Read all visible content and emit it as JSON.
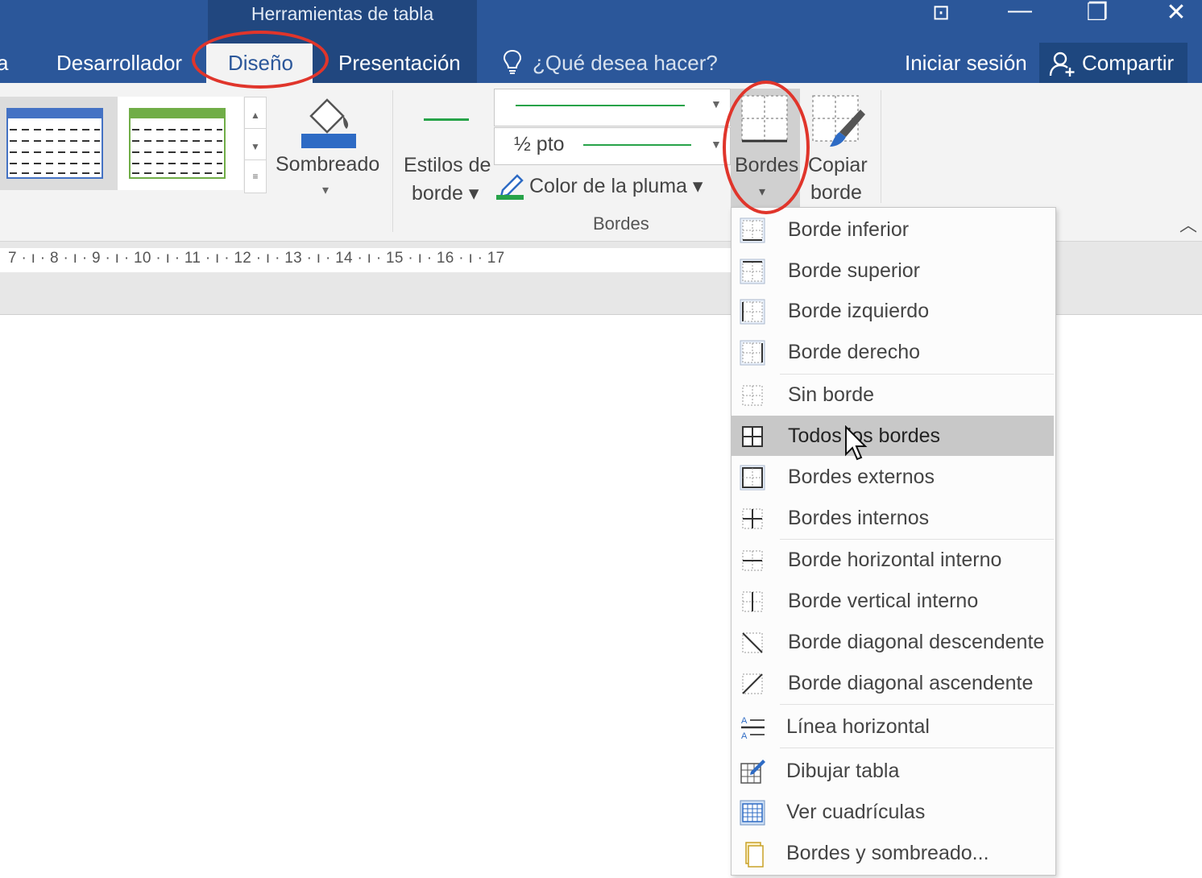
{
  "window": {
    "context_group": "Herramientas de tabla",
    "controls": {
      "ribbon_display": "⊡",
      "minimize": "—",
      "restore": "❐",
      "close": "✕"
    }
  },
  "tabs": [
    {
      "label": "a"
    },
    {
      "label": "Desarrollador"
    },
    {
      "label": "Diseño",
      "selected": true
    },
    {
      "label": "Presentación"
    }
  ],
  "tell_me": {
    "placeholder": "¿Qué desea hacer?"
  },
  "account": {
    "sign_in": "Iniciar sesión",
    "share": "Compartir"
  },
  "ribbon": {
    "shading": {
      "label": "Sombreado",
      "arrow": "▾"
    },
    "border_styles": {
      "line1": "Estilos de",
      "line2": "borde ▾"
    },
    "pen_weight": {
      "value": "½ pto"
    },
    "pen_color": {
      "label": "Color de la pluma ▾",
      "color": "#27a349"
    },
    "group_label": "Bordes",
    "borders_button": {
      "label": "Bordes",
      "arrow": "▾"
    },
    "border_painter": {
      "line1": "Copiar",
      "line2": "borde"
    },
    "collapse_arrow": "︿"
  },
  "ruler": {
    "text": "7 · ı · 8 · ı · 9 · ı · 10 · ı · 11 · ı · 12 · ı · 13 · ı · 14 · ı · 15 · ı · 16 · ı · 17"
  },
  "borders_menu": {
    "items": [
      {
        "label": "Borde inferior",
        "icon": "bottom-border-icon"
      },
      {
        "label": "Borde superior",
        "icon": "top-border-icon"
      },
      {
        "label": "Borde izquierdo",
        "icon": "left-border-icon"
      },
      {
        "label": "Borde derecho",
        "icon": "right-border-icon"
      },
      {
        "label": "Sin borde",
        "icon": "no-border-icon"
      },
      {
        "label": "Todos los bordes",
        "icon": "all-borders-icon",
        "hovered": true
      },
      {
        "label": "Bordes externos",
        "icon": "outside-borders-icon"
      },
      {
        "label": "Bordes internos",
        "icon": "inside-borders-icon"
      },
      {
        "label": "Borde horizontal interno",
        "icon": "inside-horizontal-border-icon"
      },
      {
        "label": "Borde vertical interno",
        "icon": "inside-vertical-border-icon"
      },
      {
        "label": "Borde diagonal descendente",
        "icon": "diagonal-down-border-icon"
      },
      {
        "label": "Borde diagonal ascendente",
        "icon": "diagonal-up-border-icon"
      },
      {
        "label": "Línea horizontal",
        "icon": "horizontal-line-icon"
      },
      {
        "label": "Dibujar tabla",
        "icon": "draw-table-icon"
      },
      {
        "label": "Ver cuadrículas",
        "icon": "view-gridlines-icon"
      },
      {
        "label": "Bordes y sombreado...",
        "icon": "borders-shading-icon"
      }
    ]
  },
  "colors": {
    "title_bar": "#2b579a",
    "context_group": "#21477f",
    "annotation": "#e0352b",
    "menu_hover": "#c8c8c8"
  }
}
